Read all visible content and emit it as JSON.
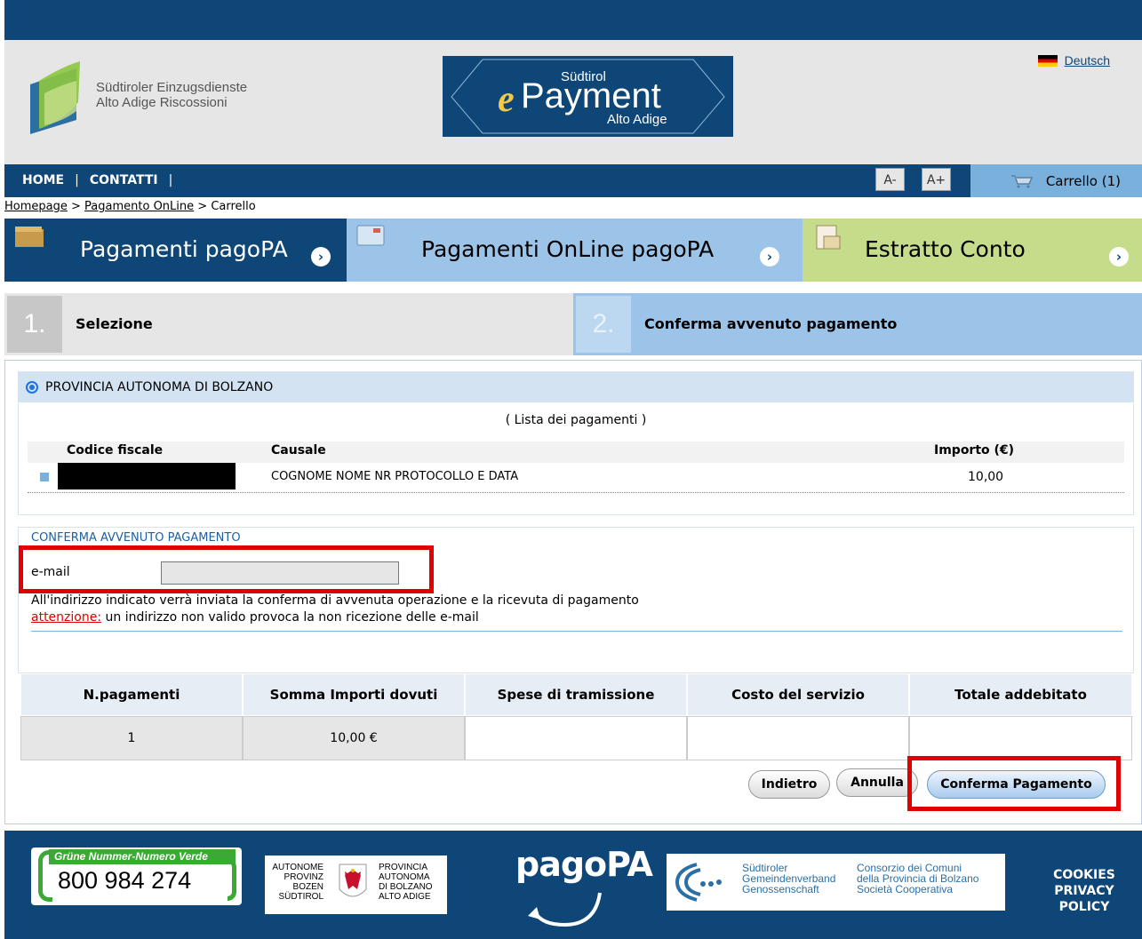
{
  "header": {
    "logo_line1": "Südtiroler Einzugsdienste",
    "logo_line2": "Alto Adige Riscossioni",
    "brand_top": "Südtirol",
    "brand_e": "e",
    "brand_main": "Payment",
    "brand_bottom": "Alto Adige",
    "language": "Deutsch"
  },
  "nav": {
    "home": "HOME",
    "contatti": "CONTATTI",
    "sep": "|",
    "font_minus": "A-",
    "font_plus": "A+",
    "cart": "Carrello (1)"
  },
  "breadcrumb": {
    "home": "Homepage",
    "sep": ">",
    "section": "Pagamento OnLine",
    "current": "Carrello"
  },
  "tiles": [
    {
      "label": "Pagamenti pagoPA",
      "arrow": "›",
      "color": "#0d4677"
    },
    {
      "label": "Pagamenti OnLine pagoPA",
      "arrow": "›",
      "color": "#9cc3e8"
    },
    {
      "label": "Estratto Conto",
      "arrow": "›",
      "color": "#c5dc8a"
    }
  ],
  "steps": [
    {
      "num": "1.",
      "label": "Selezione",
      "active": false
    },
    {
      "num": "2.",
      "label": "Conferma avvenuto pagamento",
      "active": true
    }
  ],
  "payments": {
    "entity": "PROVINCIA AUTONOMA DI BOLZANO",
    "list_title": "( Lista dei pagamenti )",
    "col_fiscal": "Codice fiscale",
    "col_causale": "Causale",
    "col_amount": "Importo (€)",
    "rows": [
      {
        "causale": "COGNOME NOME NR PROTOCOLLO E DATA",
        "amount": "10,00"
      }
    ]
  },
  "confirm": {
    "title": "CONFERMA AVVENUTO PAGAMENTO",
    "email_label": "e-mail",
    "email_value": "",
    "info": "All'indirizzo indicato verrà inviata la conferma di avvenuta operazione e la ricevuta di pagamento",
    "warning_label": "attenzione:",
    "warning_text": " un indirizzo non valido provoca la non ricezione delle e-mail"
  },
  "summary": {
    "headers": [
      "N.pagamenti",
      "Somma Importi dovuti",
      "Spese di tramissione",
      "Costo del servizio",
      "Totale addebitato"
    ],
    "values": [
      "1",
      "10,00 €",
      "",
      "",
      ""
    ]
  },
  "buttons": {
    "back": "Indietro",
    "cancel": "Annulla",
    "confirm": "Conferma Pagamento"
  },
  "footer": {
    "green_title": "Grüne Nummer-Numero Verde",
    "green_number": "800 984 274",
    "prov_left": [
      "AUTONOME",
      "PROVINZ",
      "BOZEN",
      "SÜDTIROL"
    ],
    "prov_right": [
      "PROVINCIA",
      "AUTONOMA",
      "DI BOLZANO",
      "ALTO ADIGE"
    ],
    "pagopa": "pagoPA",
    "consorzio_left": [
      "Südtiroler",
      "Gemeindenverband",
      "Genossenschaft"
    ],
    "consorzio_right": [
      "Consorzio dei Comuni",
      "della Provincia di Bolzano",
      "Società Cooperativa"
    ],
    "cookies": "COOKIES",
    "privacy": "PRIVACY POLICY"
  }
}
